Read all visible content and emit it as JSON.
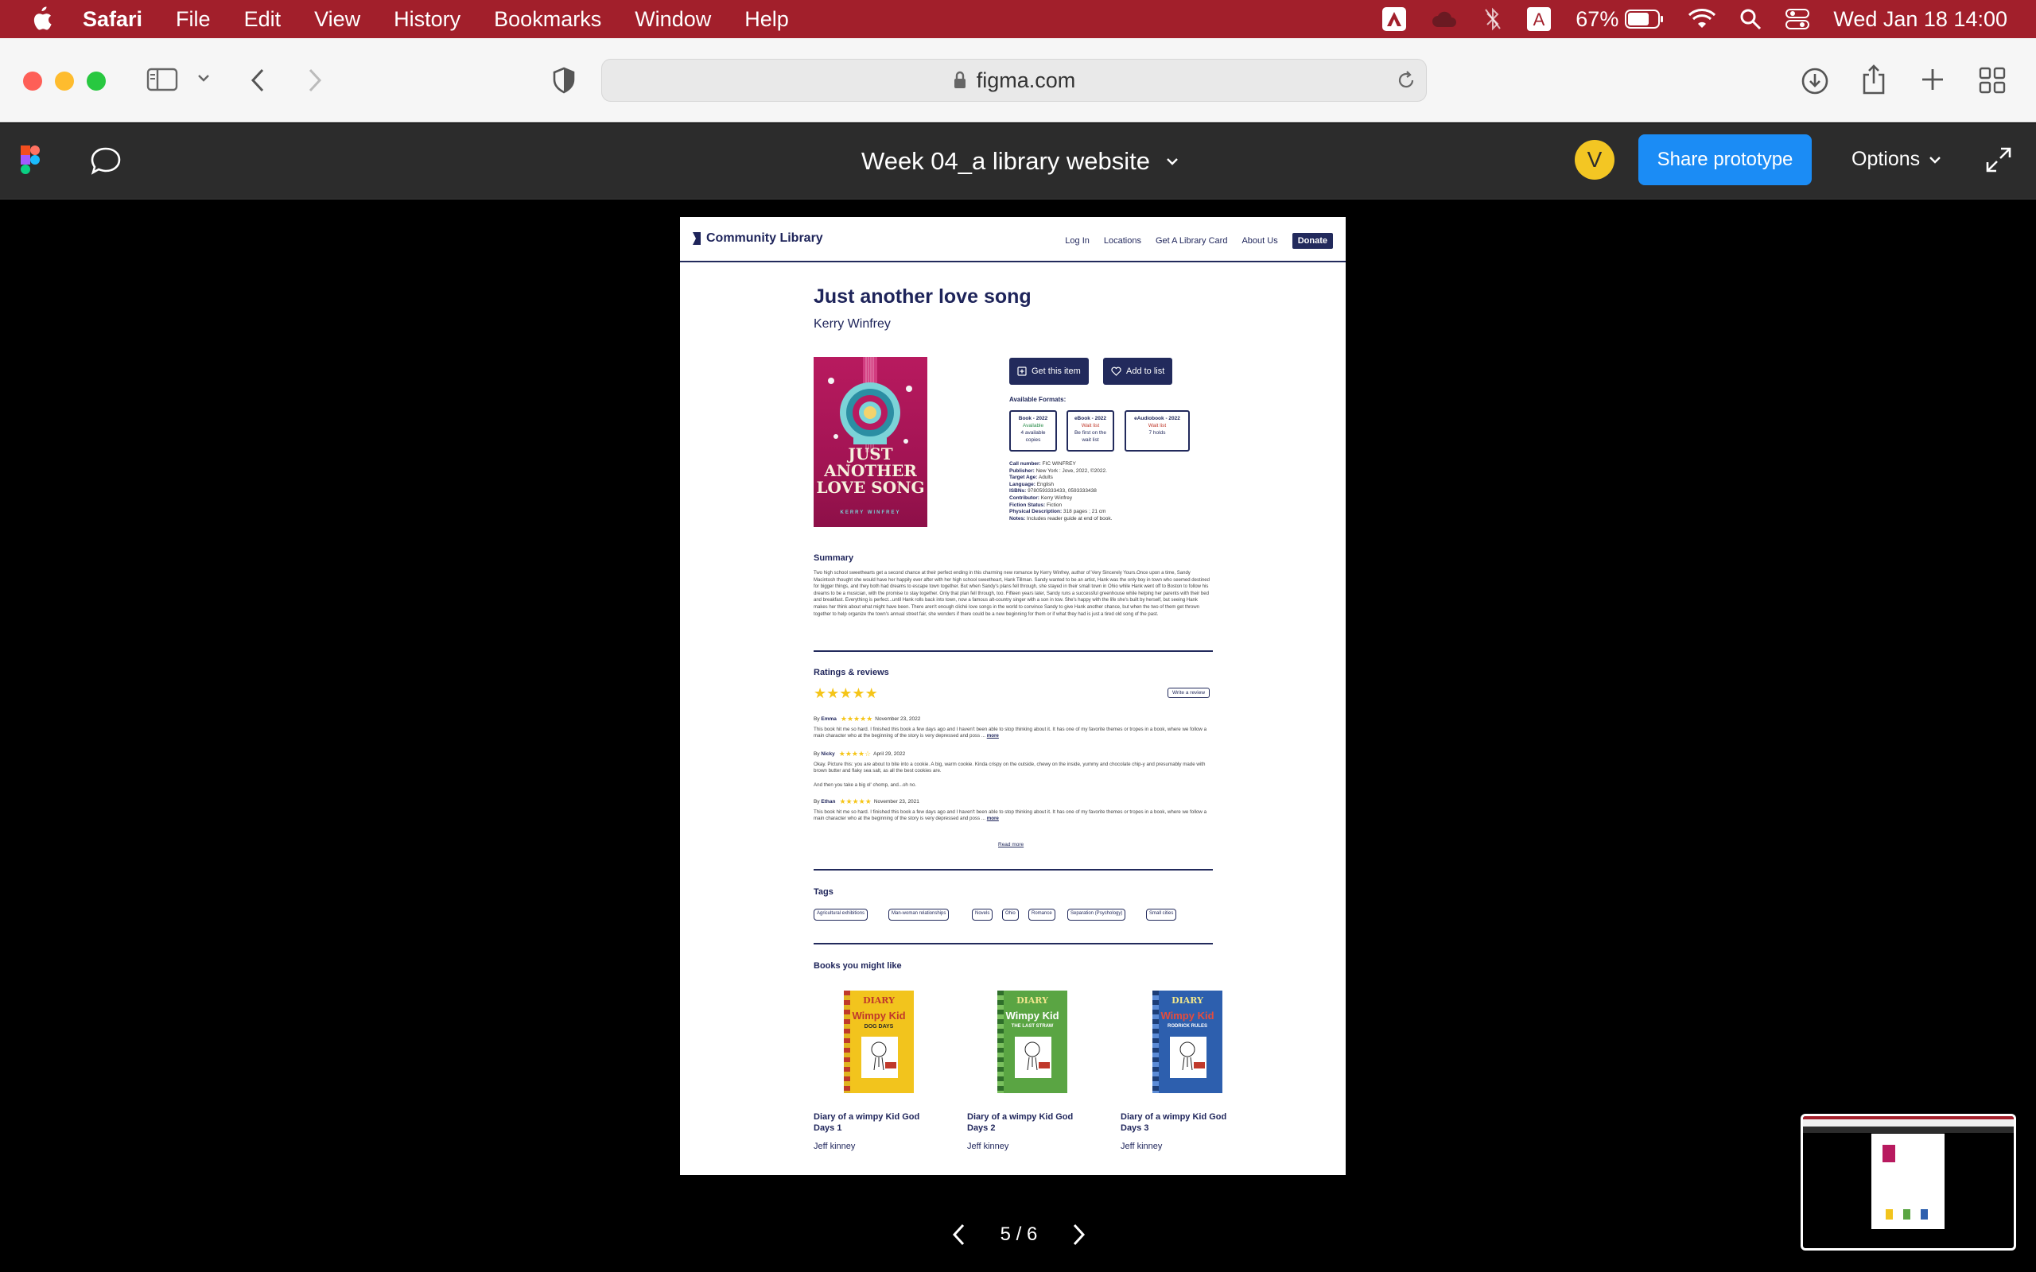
{
  "menubar": {
    "app": "Safari",
    "items": [
      "File",
      "Edit",
      "View",
      "History",
      "Bookmarks",
      "Window",
      "Help"
    ],
    "battery": "67%",
    "datetime": "Wed Jan 18  14:00"
  },
  "browser": {
    "url": "figma.com"
  },
  "figma": {
    "file_title": "Week 04_a library website",
    "avatar_letter": "V",
    "share_label": "Share prototype",
    "options_label": "Options",
    "page_indicator": "5 / 6"
  },
  "site": {
    "logo": "Community Library",
    "nav": [
      "Log In",
      "Locations",
      "Get A Library Card",
      "About Us"
    ],
    "donate": "Donate",
    "book": {
      "title": "Just another love song",
      "author": "Kerry Winfrey",
      "cover_lines": [
        "JUST",
        "ANOTHER",
        "LOVE SONG"
      ],
      "cover_author": "KERRY WINFREY",
      "get_item": "Get this item",
      "add_list": "Add to list",
      "formats_heading": "Available Formats:",
      "formats": [
        {
          "name": "Book - 2022",
          "status": "Available",
          "detail": "4 available copies",
          "color": "#2f8f4e"
        },
        {
          "name": "eBook - 2022",
          "status": "Wait list",
          "detail": "Be first on the wait list",
          "color": "#c0392b"
        },
        {
          "name": "eAudiobook - 2022",
          "status": "Wait list",
          "detail": "7 holds",
          "color": "#c0392b"
        }
      ],
      "details": [
        {
          "k": "Call number:",
          "v": "FIC WINFREY"
        },
        {
          "k": "Publisher:",
          "v": "New York : Jove, 2022, ©2022."
        },
        {
          "k": "Target Age:",
          "v": "Adults"
        },
        {
          "k": "Language:",
          "v": "English"
        },
        {
          "k": "ISBNs:",
          "v": "9780593333433, 0593333438"
        },
        {
          "k": "Contributor:",
          "v": "Kerry Winfrey"
        },
        {
          "k": "Fiction Status:",
          "v": "Fiction"
        },
        {
          "k": "Physical Description:",
          "v": "318 pages ; 21 cm"
        },
        {
          "k": "Notes:",
          "v": "Includes reader guide at end of book."
        }
      ]
    },
    "summary_heading": "Summary",
    "summary": "Two high school sweethearts get a second chance at their perfect ending in this charming new romance by Kerry Winfrey, author of Very Sincerely Yours.Once upon a time, Sandy Macintosh thought she would have her happily ever after with her high school sweetheart, Hank Tillman. Sandy wanted to be an artist, Hank was the only boy in town who seemed destined for bigger things, and they both had dreams to escape town together. But when Sandy's plans fell through, she stayed in their small town in Ohio while Hank went off to Boston to follow his dreams to be a musician, with the promise to stay together. Only that plan fell through, too. Fifteen years later, Sandy runs a successful greenhouse while helping her parents with their bed and breakfast. Everything is perfect...until Hank rolls back into town, now a famous alt-country singer with a son in tow. She's happy with the life she's built by herself, but seeing Hank makes her think about what might have been. There aren't enough cliché love songs in the world to convince Sandy to give Hank another chance, but when the two of them get thrown together to help organize the town's annual street fair, she wonders if there could be a new beginning for them or if what they had is just a tired old song of the past.",
    "ratings_heading": "Ratings & reviews",
    "write_review": "Write a review",
    "reviews": [
      {
        "by": "By",
        "name": "Emma",
        "stars": 5,
        "date": "November 23, 2022",
        "text": "This book hit me so hard. I finished this book a few days ago and I haven't been able to stop thinking about it. It has one of my favorite themes or tropes in a book, where we follow a main character who at the beginning of the story is very depressed and poss ...",
        "more": "more"
      },
      {
        "by": "By",
        "name": "Nicky",
        "stars": 4,
        "date": "April 29, 2022",
        "text": "Okay. Picture this: you are about to bite into a cookie. A big, warm cookie. Kinda crispy on the outside, chewy on the inside, yummy and chocolate chip-y and presumably made with brown butter and flaky sea salt, as all the best cookies are.",
        "text2": "And then you take a big ol' chomp, and...oh no.",
        "more": ""
      },
      {
        "by": "By",
        "name": "Ethan",
        "stars": 5,
        "date": "November 23, 2021",
        "text": "This book hit me so hard. I finished this book a few days ago and I haven't been able to stop thinking about it. It has one of my favorite themes or tropes in a book, where we follow a main character who at the beginning of the story is very depressed and poss ...",
        "more": "more"
      }
    ],
    "overall_stars": 5,
    "read_more": "Read more",
    "tags_heading": "Tags",
    "tags": [
      "Agricultural exhibitions",
      "Man-woman relationships",
      "Novels",
      "Ohio",
      "Romance",
      "Separation (Psychology)",
      "Small cities"
    ],
    "recs_heading": "Books you might like",
    "recs": [
      {
        "title": "Diary of a wimpy Kid God Days 1",
        "author": "Jeff kinney",
        "cover_top": "DIARY",
        "cover_mid": "Wimpy Kid",
        "cover_sub": "DOG DAYS",
        "bg": "#f2c41d",
        "spine": "#c0392b"
      },
      {
        "title": "Diary of a wimpy Kid God Days 2",
        "author": "Jeff kinney",
        "cover_top": "DIARY",
        "cover_mid": "Wimpy Kid",
        "cover_sub": "THE LAST STRAW",
        "bg": "#5aa543",
        "spine": "#2f6e2a"
      },
      {
        "title": "Diary of a wimpy Kid God Days 3",
        "author": "Jeff kinney",
        "cover_top": "DIARY",
        "cover_mid": "Wimpy Kid",
        "cover_sub": "RODRICK RULES",
        "bg": "#2d5fae",
        "spine": "#1c3d77"
      }
    ]
  }
}
